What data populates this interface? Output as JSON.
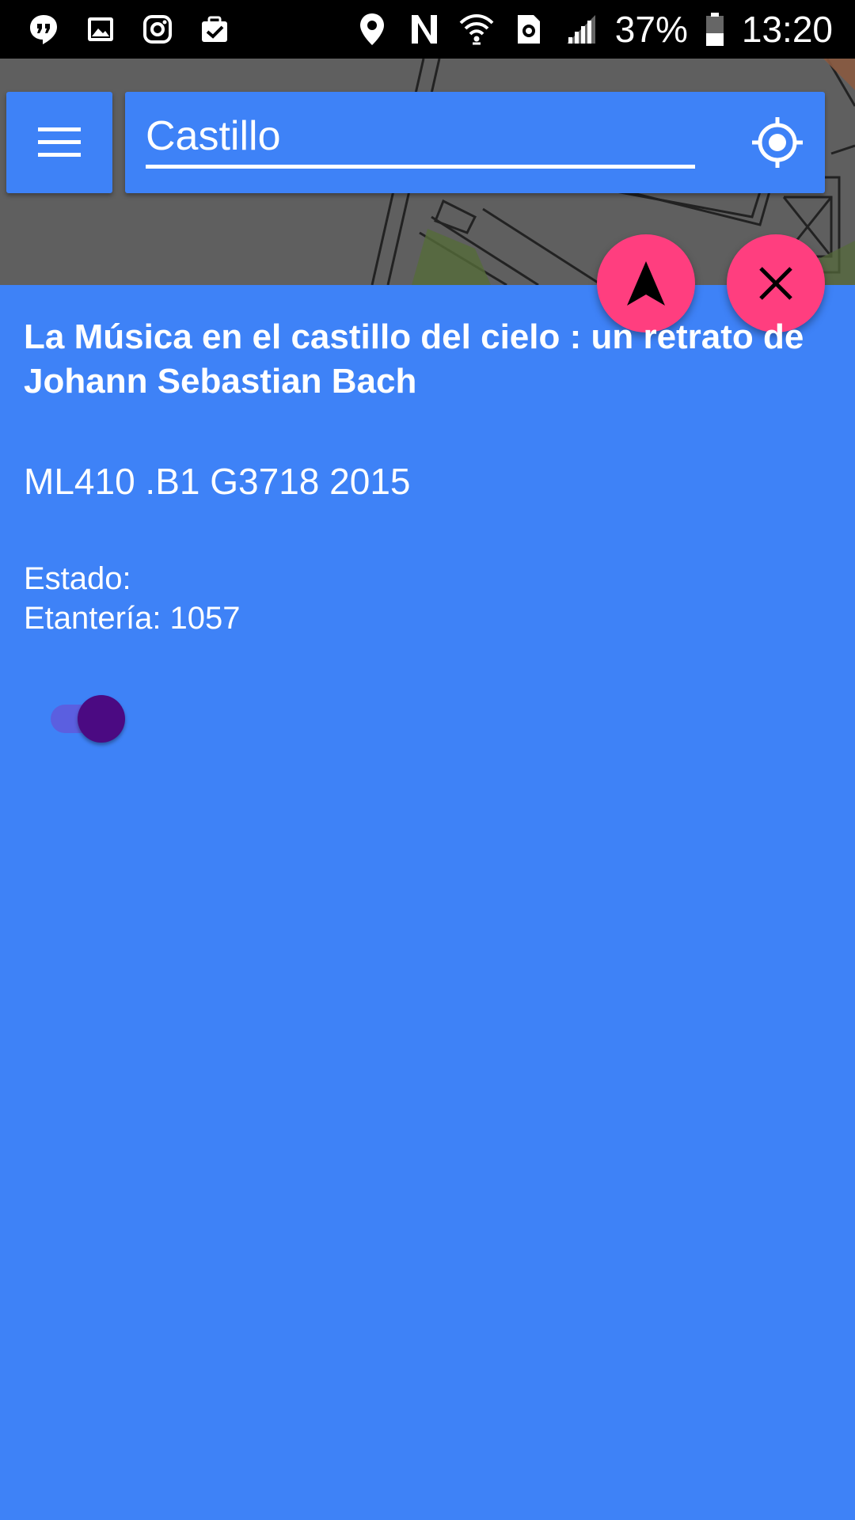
{
  "status_bar": {
    "battery_percent": "37%",
    "time": "13:20",
    "left_icons": [
      "hangouts-icon",
      "gallery-icon",
      "instagram-icon",
      "clipboard-check-icon"
    ],
    "right_icons": [
      "location-pin-icon",
      "nfc-icon",
      "wifi-icon",
      "data-saver-icon",
      "signal-icon",
      "battery-icon"
    ]
  },
  "search": {
    "value": "Castillo"
  },
  "colors": {
    "panel_background": "#3E82F7",
    "fab": "#FF3E7F",
    "toggle_thumb": "#4B0A82",
    "toggle_track": "#5B5FE0"
  },
  "fabs": {
    "navigate_icon": "navigation-arrow-icon",
    "close_icon": "close-icon"
  },
  "item": {
    "title": "La Música en el castillo del cielo : un retrato de Johann Sebastian Bach",
    "call_number": "ML410 .B1 G3718 2015",
    "status_label": "Estado:",
    "shelf_label": "Etantería: 1057"
  },
  "toggle": {
    "checked": true
  }
}
